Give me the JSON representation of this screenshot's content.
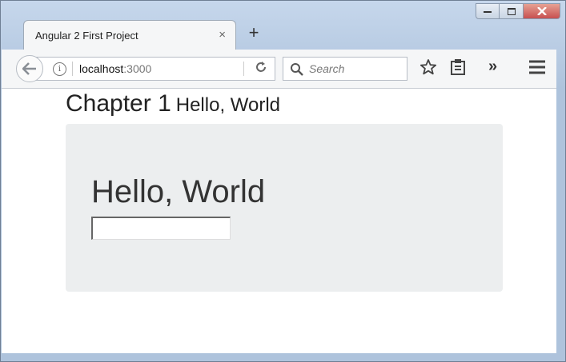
{
  "browser": {
    "tab": {
      "title": "Angular 2 First Project",
      "close_glyph": "×"
    },
    "new_tab_glyph": "+",
    "url": {
      "host": "localhost",
      "port": ":3000"
    },
    "search": {
      "placeholder": "Search"
    },
    "overflow_glyph": "»"
  },
  "page": {
    "heading_main": "Chapter 1",
    "heading_sub": "Hello, World",
    "greeting": "Hello, World",
    "name_input_value": ""
  },
  "icons": {
    "back": "back-arrow-icon",
    "info": "info-icon",
    "reload": "reload-icon",
    "search": "search-icon",
    "bookmark": "star-icon",
    "reading_list": "clipboard-icon",
    "overflow": "chevron-double-right-icon",
    "menu": "hamburger-menu-icon"
  },
  "colors": {
    "jumbotron": "#eceeef",
    "window_frame": "#b9cce2",
    "toolbar": "#f5f6f7"
  }
}
